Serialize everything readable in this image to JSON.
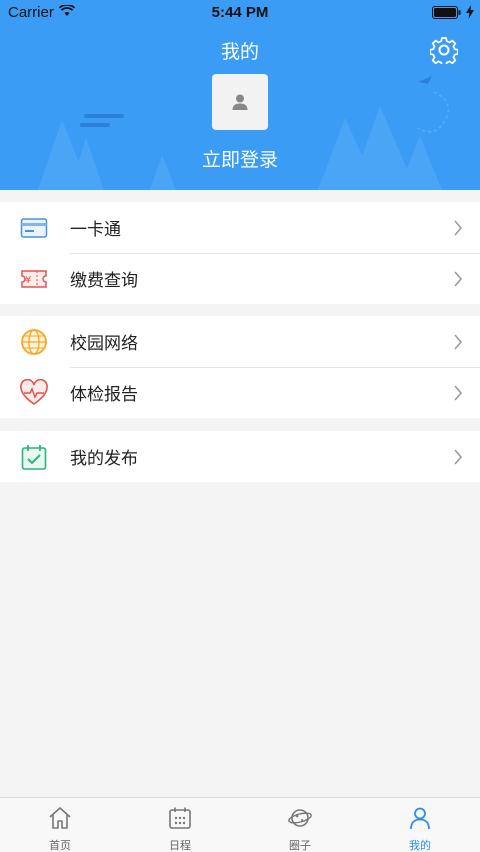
{
  "status_bar": {
    "carrier": "Carrier",
    "time": "5:44 PM"
  },
  "header": {
    "title": "我的",
    "login_text": "立即登录"
  },
  "menu": [
    {
      "label": "一卡通",
      "icon": "card-icon"
    },
    {
      "label": "缴费查询",
      "icon": "payment-ticket-icon"
    },
    {
      "label": "校园网络",
      "icon": "globe-icon"
    },
    {
      "label": "体检报告",
      "icon": "heart-pulse-icon"
    },
    {
      "label": "我的发布",
      "icon": "calendar-check-icon"
    }
  ],
  "tabbar": {
    "tabs": [
      {
        "label": "首页",
        "icon": "home-icon"
      },
      {
        "label": "日程",
        "icon": "calendar-icon"
      },
      {
        "label": "圈子",
        "icon": "planet-icon"
      },
      {
        "label": "我的",
        "icon": "person-icon"
      }
    ],
    "active_index": 3
  },
  "colors": {
    "header_bg": "#3b9cf6",
    "active_tab": "#2d8cf0",
    "page_bg": "#f4f4f4"
  }
}
